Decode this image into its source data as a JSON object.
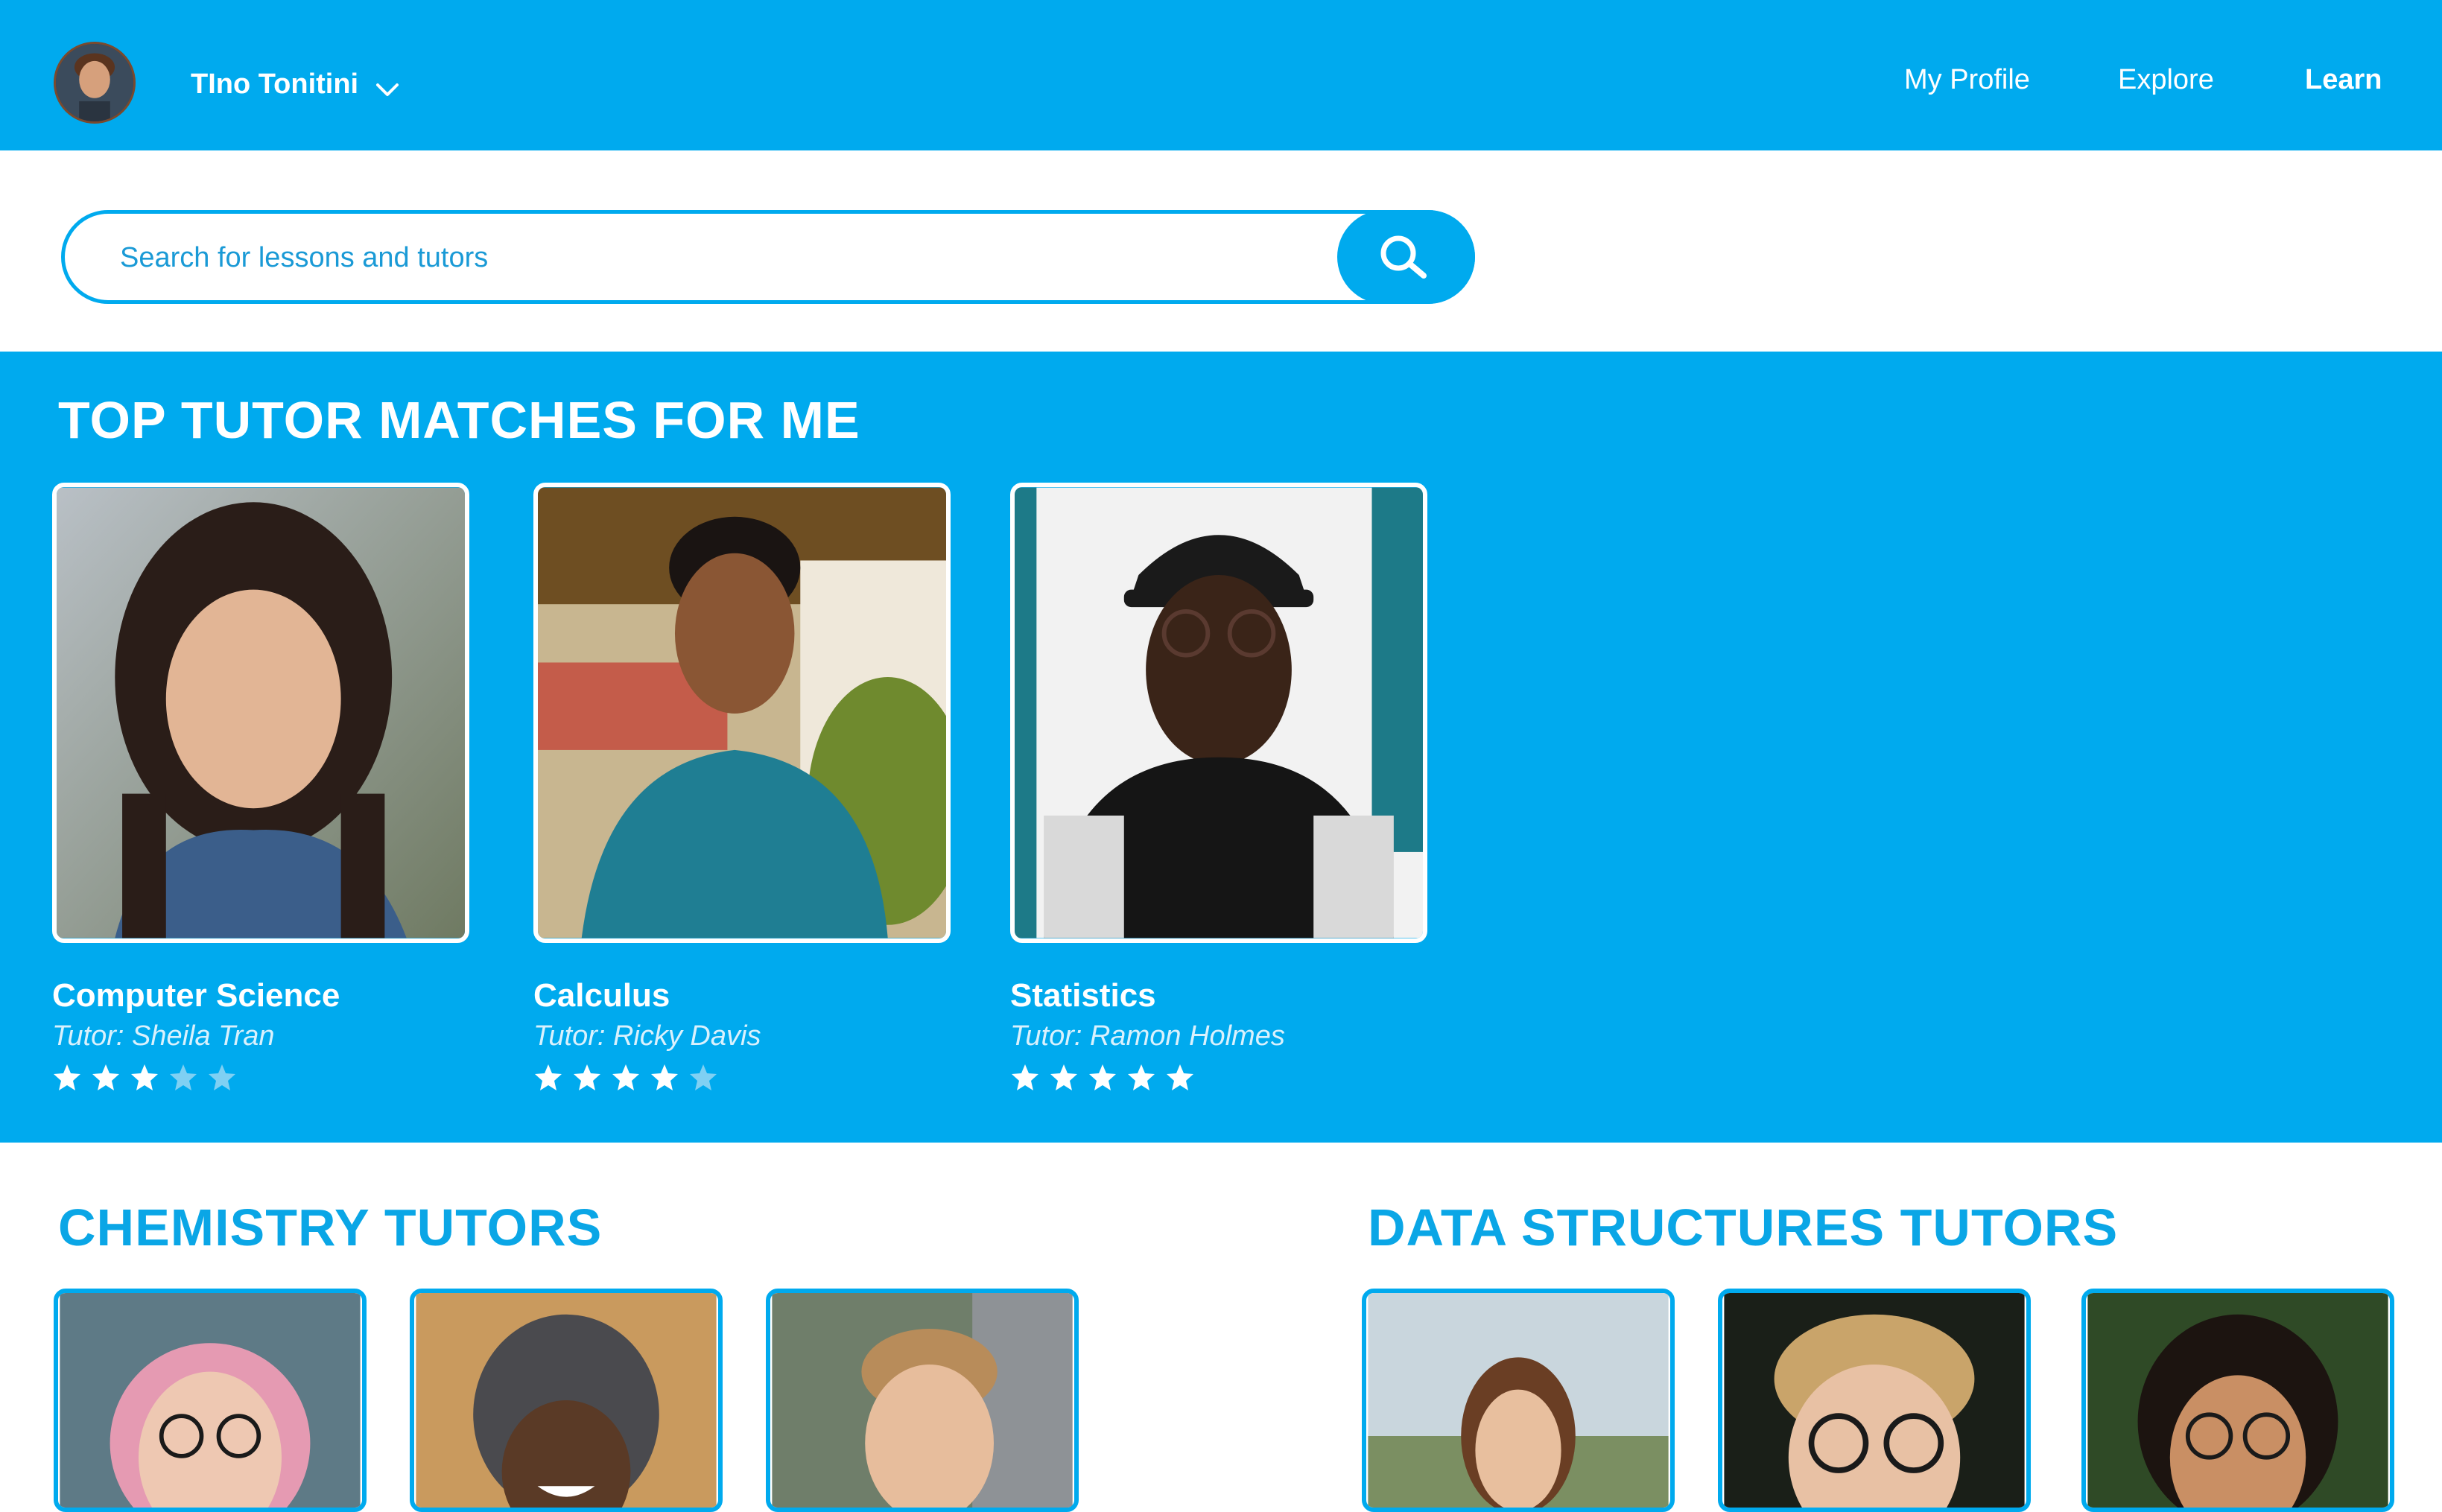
{
  "header": {
    "user_name": "TIno Tonitini",
    "nav": [
      {
        "label": "My Profile"
      },
      {
        "label": "Explore"
      },
      {
        "label": "Learn"
      }
    ]
  },
  "search": {
    "placeholder": "Search for lessons and tutors"
  },
  "top_matches": {
    "title": "TOP TUTOR MATCHES FOR ME",
    "tutors": [
      {
        "subject": "Computer Science",
        "tutor": "Tutor: Sheila Tran",
        "rating": 3,
        "max_rating": 5
      },
      {
        "subject": "Calculus",
        "tutor": "Tutor: Ricky Davis",
        "rating": 4,
        "max_rating": 5
      },
      {
        "subject": "Statistics",
        "tutor": "Tutor: Ramon Holmes",
        "rating": 5,
        "max_rating": 5
      }
    ]
  },
  "chemistry": {
    "title": "CHEMISTRY TUTORS"
  },
  "data_structures": {
    "title": "DATA STRUCTURES TUTORS"
  },
  "colors": {
    "brand_blue": "#00aaee",
    "star_filled": "#ffffff",
    "star_empty": "#7fd0f3"
  }
}
